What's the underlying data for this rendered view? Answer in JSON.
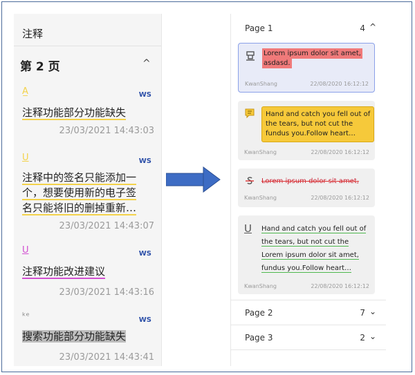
{
  "left": {
    "title": "注释",
    "page_heading": "第 2 页",
    "annotations": [
      {
        "icon": "highlight-icon",
        "icon_glyph": "A̲",
        "user": "WS",
        "text": "注释功能部分功能缺失",
        "time": "23/03/2021 14:43:03"
      },
      {
        "icon": "underline-icon",
        "icon_glyph": "U",
        "user": "WS",
        "text_lines": [
          "注释中的签名只能添加一",
          "个，想要使用新的电子签",
          "名只能将旧的删掉重新…"
        ],
        "time": "23/03/2021 14:43:07"
      },
      {
        "icon": "underline-icon",
        "icon_glyph": "U",
        "user": "WS",
        "text": "注释功能改进建议",
        "time": "23/03/2021 14:43:16"
      },
      {
        "icon": "squiggly-icon",
        "icon_glyph": "ᵏᵉ",
        "user": "WS",
        "text": "搜索功能部分功能缺失",
        "time": "23/03/2021 14:43:41"
      }
    ]
  },
  "right": {
    "pages": [
      {
        "label": "Page 1",
        "count": "4",
        "chevron": "^"
      },
      {
        "label": "Page 2",
        "count": "7",
        "chevron": "⌄"
      },
      {
        "label": "Page 3",
        "count": "2",
        "chevron": "⌄"
      }
    ],
    "cards": [
      {
        "icon": "highlight-icon",
        "lines": [
          "Lorem ipsum dolor sit amet,",
          "asdasd."
        ],
        "user": "KwanShang",
        "date": "22/08/2020 16:12:12"
      },
      {
        "icon": "note-icon",
        "lines": [
          "Hand and catch you fell out of",
          "the tears, but not cut the",
          "fundus you.Follow heart…"
        ],
        "user": "KwanShang",
        "date": "22/08/2020 16:12:12"
      },
      {
        "icon": "strikethrough-icon",
        "lines": [
          "Lorem ipsum dolor sit amet,"
        ],
        "user": "KwanShang",
        "date": "22/08/2020 16:12:12"
      },
      {
        "icon": "underline-icon",
        "lines": [
          "Hand and catch you fell out of",
          "the tears, but not cut the",
          "Lorem ipsum dolor sit amet,",
          "fundus you.Follow heart…"
        ],
        "user": "KwanShang",
        "date": "22/08/2020 16:12:12"
      }
    ]
  },
  "colors": {
    "accent_blue": "#2c4fa8",
    "arrow": "#3d6cc4",
    "highlight_red": "#f07a7a",
    "note_yellow": "#f6c93a",
    "underline_green": "#4db84d"
  }
}
